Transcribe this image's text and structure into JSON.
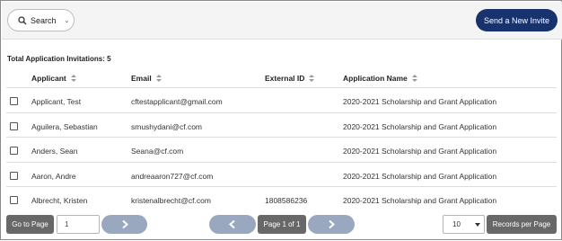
{
  "search": {
    "label": "Search"
  },
  "send_invite": {
    "label": "Send a New Invite"
  },
  "summary": {
    "total_label": "Total Application Invitations: 5"
  },
  "table": {
    "columns": [
      "Applicant",
      "Email",
      "External ID",
      "Application Name"
    ],
    "rows": [
      {
        "applicant": "Applicant, Test",
        "email": "cftestapplicant@gmail.com",
        "external_id": "",
        "application": "2020-2021 Scholarship and Grant Application"
      },
      {
        "applicant": "Aguilera, Sebastian",
        "email": "smushydani@cf.com",
        "external_id": "",
        "application": "2020-2021 Scholarship and Grant Application"
      },
      {
        "applicant": "Anders, Sean",
        "email": "Seana@cf.com",
        "external_id": "",
        "application": "2020-2021 Scholarship and Grant Application"
      },
      {
        "applicant": "Aaron, Andre",
        "email": "andreaaron727@cf.com",
        "external_id": "",
        "application": "2020-2021 Scholarship and Grant Application"
      },
      {
        "applicant": "Albrecht, Kristen",
        "email": "kristenalbrecht@cf.com",
        "external_id": "1808586236",
        "application": "2020-2021 Scholarship and Grant Application"
      }
    ]
  },
  "pager": {
    "go_to_page": "Go to Page",
    "page_value": "1",
    "page_label": "Page 1 of 1",
    "per_page_value": "10",
    "records_label": "Records per Page"
  },
  "colors": {
    "primary": "#18326e",
    "pager_button": "#686868",
    "arrow": "#9aa8bf"
  },
  "icons": {
    "search": "search-icon",
    "prev": "chevron-left-icon",
    "next": "chevron-right-icon"
  }
}
